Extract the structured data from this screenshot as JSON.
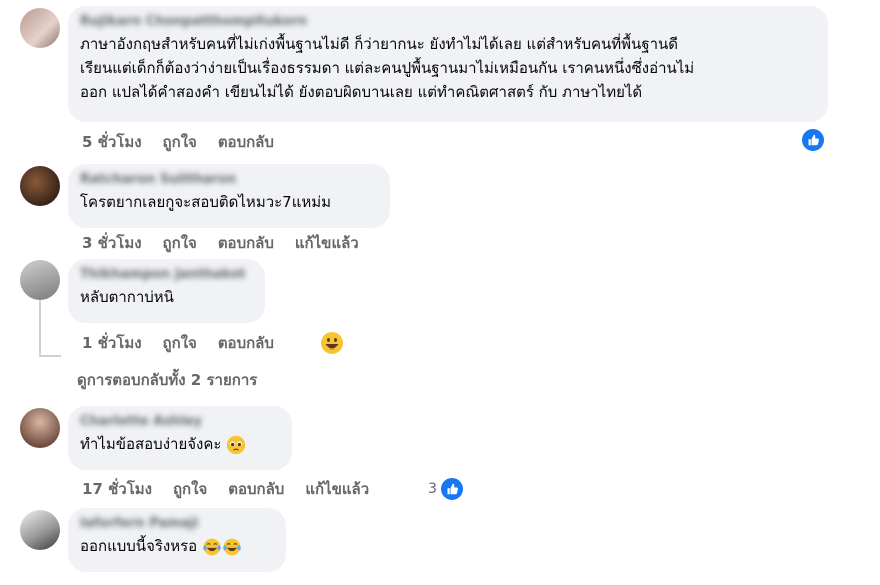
{
  "comments": [
    {
      "name": "Rujikarn Chonpatthompitukorn",
      "lines": [
        "ภาษาอังกฤษสำหรับคนที่ไม่เก่งพื้นฐานไม่ดี ก็ว่ายากนะ ยังทำไม่ได้เลย แต่สำหรับคนที่พื้นฐานดี",
        "เรียนแต่เด็กก็ต้องว่าง่ายเป็นเรื่องธรรมดา แต่ละคนปูพื้นฐานมาไม่เหมือนกัน เราคนหนึ่งซึ่งอ่านไม่",
        "ออก แปลได้คำสองคำ เขียนไม่ได้ ยังตอบผิดบานเลย แต่ทำคณิตศาสตร์ กับ ภาษาไทยได้"
      ],
      "time": "5 ชั่วโมง",
      "like": "ถูกใจ",
      "reply": "ตอบกลับ"
    },
    {
      "name": "Ratcharon Sulitharon",
      "text": "โครตยากเลยกูจะสอบติดไหมวะ7แหม่ม",
      "time": "3 ชั่วโมง",
      "like": "ถูกใจ",
      "reply": "ตอบกลับ",
      "edited": "แก้ไขแล้ว"
    },
    {
      "name": "Thikhampon Janthakot",
      "text": "หลับตากาบ่หนิ",
      "time": "1 ชั่วโมง",
      "like": "ถูกใจ",
      "reply": "ตอบกลับ"
    },
    {
      "name": "Charlotte Ashley",
      "text": "ทำไมข้อสอบง่ายจังคะ",
      "time": "17 ชั่วโมง",
      "like": "ถูกใจ",
      "reply": "ตอบกลับ",
      "edited": "แก้ไขแล้ว",
      "reaction_count": "3"
    },
    {
      "name": "Iaforfern Pamaji",
      "text": "ออกแบบนี้จริงหรอ"
    }
  ],
  "view_replies": "ดูการตอบกลับทั้ง 2 รายการ",
  "colors": {
    "like_blue": "#1877f2",
    "bubble": "#f0f2f5",
    "meta": "#65676b"
  },
  "icons": [
    "like-reaction-icon",
    "grinning-emoji-icon",
    "pleading-emoji-icon",
    "tears-of-joy-emoji-icon"
  ]
}
